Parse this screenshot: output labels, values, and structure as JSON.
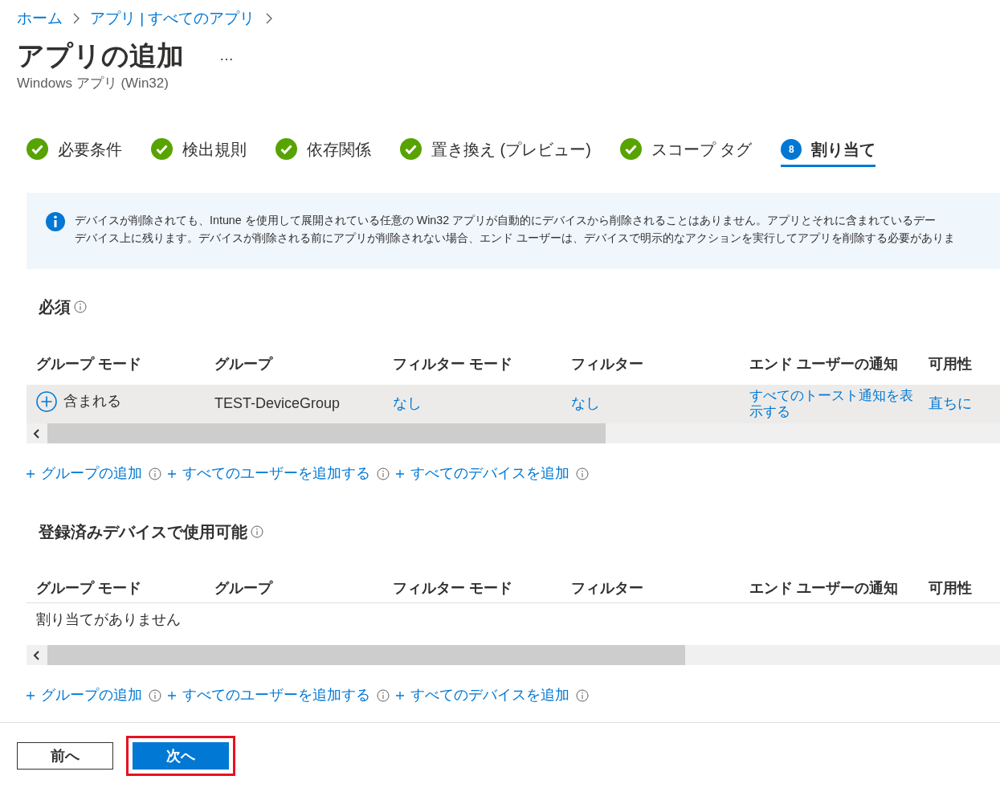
{
  "breadcrumb": [
    "ホーム",
    "アプリ | すべてのアプリ"
  ],
  "header": {
    "title": "アプリの追加",
    "more": "…",
    "subtitle": "Windows アプリ (Win32)"
  },
  "steps": [
    {
      "label": "必要条件",
      "completed": true,
      "selected": false
    },
    {
      "label": "検出規則",
      "completed": true,
      "selected": false
    },
    {
      "label": "依存関係",
      "completed": true,
      "selected": false
    },
    {
      "label": "置き換え (プレビュー)",
      "completed": true,
      "selected": false
    },
    {
      "label": "スコープ タグ",
      "completed": true,
      "selected": false
    },
    {
      "label": "割り当て",
      "completed": false,
      "number": "8",
      "selected": true
    }
  ],
  "info_banner": {
    "lines": [
      "デバイスが削除されても、Intune を使用して展開されている任意の Win32 アプリが自動的にデバイスから削除されることはありません。アプリとそれに含まれているデー",
      "デバイス上に残ります。デバイスが削除される前にアプリが削除されない場合、エンド ユーザーは、デバイスで明示的なアクションを実行してアプリを削除する必要がありま"
    ]
  },
  "sections": [
    {
      "title": "必須",
      "columns": [
        "グループ モード",
        "グループ",
        "フィルター モード",
        "フィルター",
        "エンド ユーザーの通知",
        "可用性"
      ],
      "rows": [
        {
          "group_mode": "含まれる",
          "group": "TEST-DeviceGroup",
          "filter_mode": "なし",
          "filter": "なし",
          "notification": "すべてのトースト通知を表示する",
          "availability": "直ちに"
        }
      ],
      "links": [
        "グループの追加",
        "すべてのユーザーを追加する",
        "すべてのデバイスを追加"
      ]
    },
    {
      "title": "登録済みデバイスで使用可能",
      "columns": [
        "グループ モード",
        "グループ",
        "フィルター モード",
        "フィルター",
        "エンド ユーザーの通知",
        "可用性"
      ],
      "empty_text": "割り当てがありません",
      "links": [
        "グループの追加",
        "すべてのユーザーを追加する",
        "すべてのデバイスを追加"
      ]
    }
  ],
  "footer": {
    "buttons": [
      {
        "label": "前へ",
        "kind": "secondary",
        "highlighted": false
      },
      {
        "label": "次へ",
        "kind": "primary",
        "highlighted": true
      }
    ]
  }
}
